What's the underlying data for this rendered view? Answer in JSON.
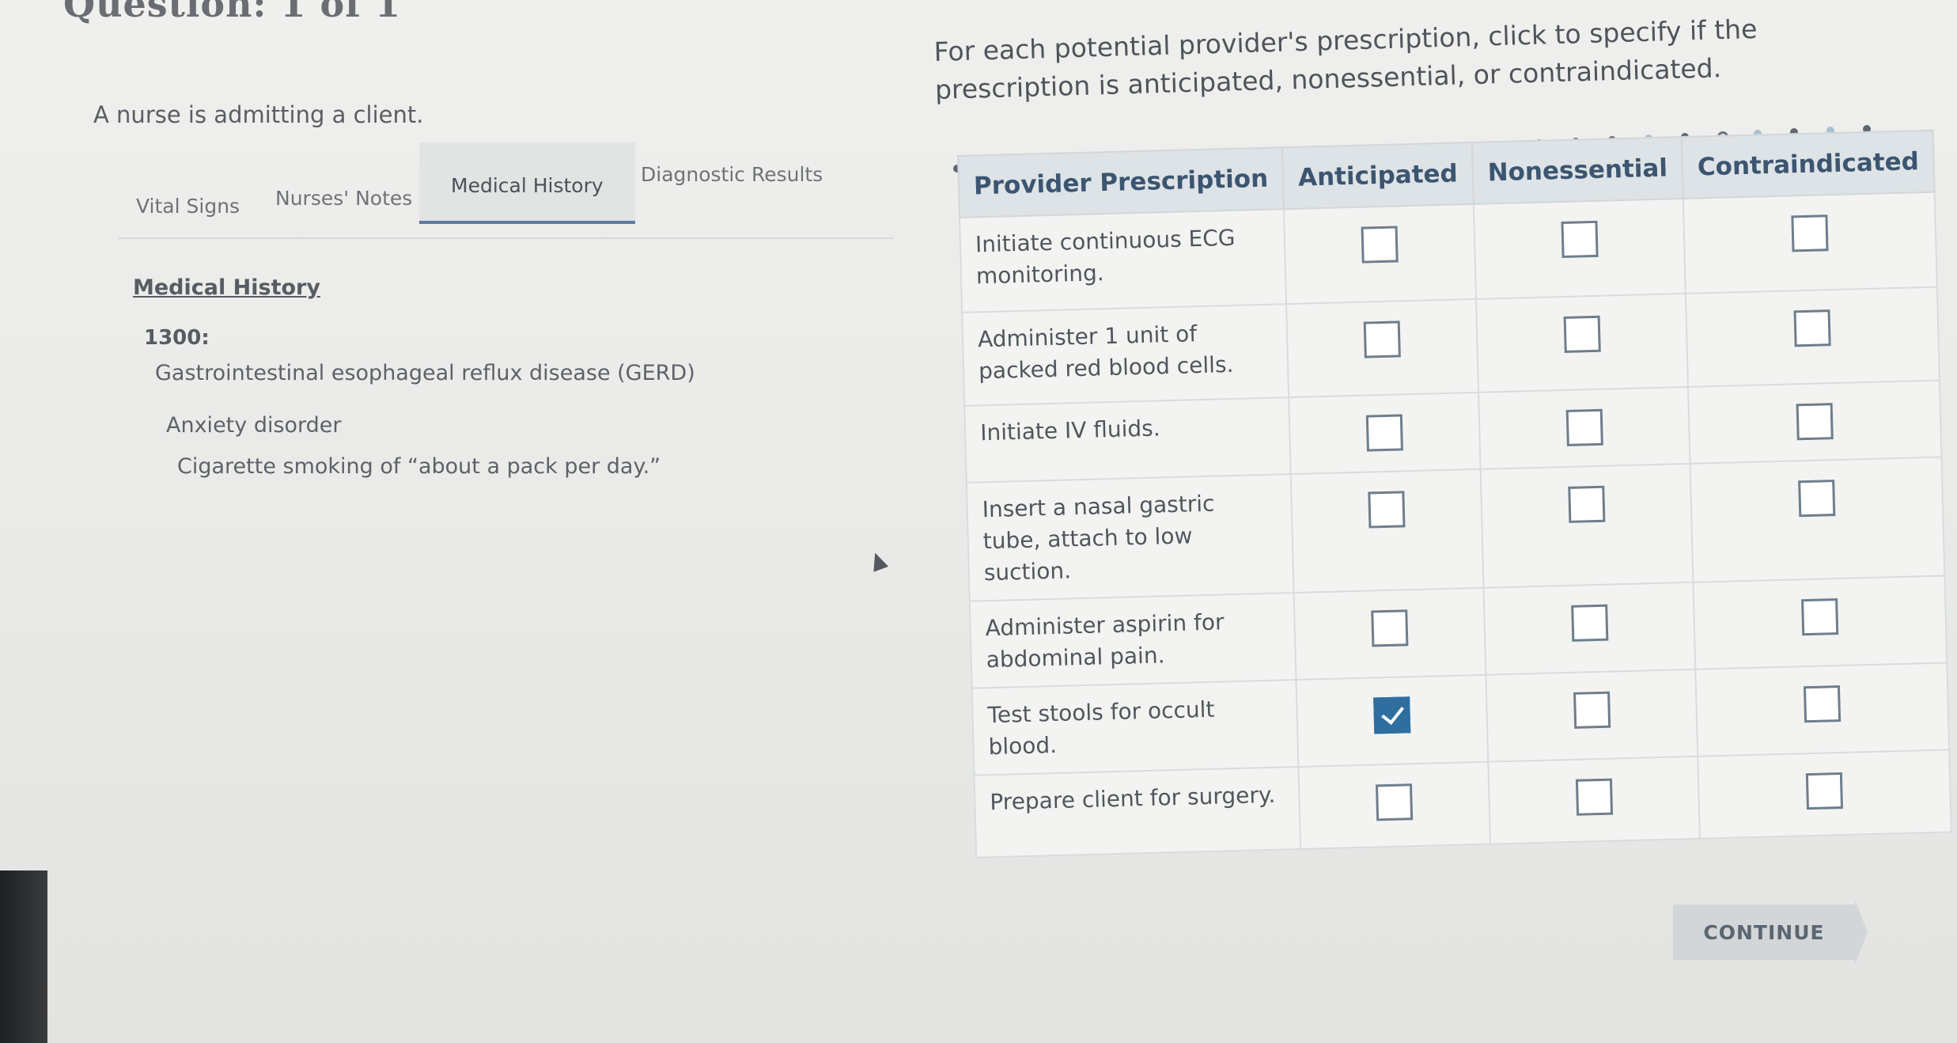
{
  "question": {
    "title": "Question: 1 of 1"
  },
  "intro": "A nurse is admitting a client.",
  "tabs": [
    {
      "label": "Vital Signs"
    },
    {
      "label": "Nurses' Notes"
    },
    {
      "label": "Medical History",
      "active": true
    },
    {
      "label": "Diagnostic Results"
    }
  ],
  "medical_history": {
    "heading": "Medical History",
    "time": "1300:",
    "items": [
      "Gastrointestinal esophageal reflux disease (GERD)",
      "Anxiety disorder",
      "Cigarette smoking of “about a pack per day.”"
    ]
  },
  "instructions": "For each potential provider's prescription, click to specify if the prescription is anticipated, nonessential, or contraindicated.",
  "table": {
    "headers": [
      "Provider Prescription",
      "Anticipated",
      "Nonessential",
      "Contraindicated"
    ],
    "rows": [
      {
        "prescription": "Initiate continuous ECG monitoring.",
        "anticipated": false,
        "nonessential": false,
        "contraindicated": false
      },
      {
        "prescription": "Administer 1 unit of packed red blood cells.",
        "anticipated": false,
        "nonessential": false,
        "contraindicated": false
      },
      {
        "prescription": "Initiate IV fluids.",
        "anticipated": false,
        "nonessential": false,
        "contraindicated": false
      },
      {
        "prescription": "Insert a nasal gastric tube, attach to low suction.",
        "anticipated": false,
        "nonessential": false,
        "contraindicated": false
      },
      {
        "prescription": "Administer aspirin for abdominal pain.",
        "anticipated": false,
        "nonessential": false,
        "contraindicated": false
      },
      {
        "prescription": "Test stools for occult blood.",
        "anticipated": true,
        "nonessential": false,
        "contraindicated": false
      },
      {
        "prescription": "Prepare client for surgery.",
        "anticipated": false,
        "nonessential": false,
        "contraindicated": false
      }
    ]
  },
  "continue_label": "CONTINUE",
  "colors": {
    "header_text": "#3c5570",
    "checked": "#2f6fa0",
    "active_tab_underline": "#5a7ba0"
  }
}
